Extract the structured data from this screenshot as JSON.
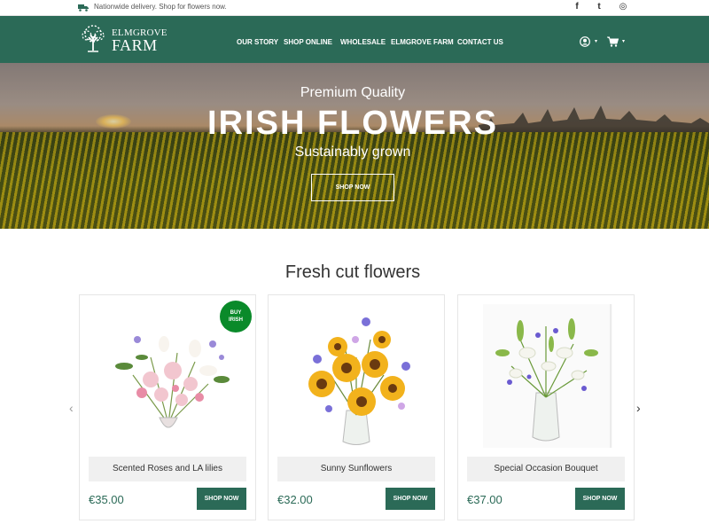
{
  "topbar": {
    "promo": "Nationwide delivery. Shop for flowers now.",
    "social": [
      {
        "icon": "facebook-icon",
        "glyph": "f"
      },
      {
        "icon": "twitter-icon",
        "glyph": "t"
      },
      {
        "icon": "instagram-icon",
        "glyph": "◎"
      }
    ]
  },
  "header": {
    "logo_line1": "ELMGROVE",
    "logo_line2": "FARM",
    "nav": [
      "OUR STORY",
      "SHOP ONLINE",
      "WHOLESALE",
      "ELMGROVE FARM",
      "CONTACT US"
    ],
    "account_icon": "user-circle-icon",
    "cart_icon": "cart-icon"
  },
  "hero": {
    "kicker": "Premium Quality",
    "headline": "IRISH FLOWERS",
    "subtitle": "Sustainably grown",
    "cta": "SHOP NOW"
  },
  "section": {
    "title": "Fresh cut flowers",
    "prev_arrow": "‹",
    "next_arrow": "›"
  },
  "products": [
    {
      "name": "Scented Roses and LA lilies",
      "price": "€35.00",
      "button": "SHOP NOW",
      "badge": "BUY IRISH"
    },
    {
      "name": "Sunny Sunflowers",
      "price": "€32.00",
      "button": "SHOP NOW"
    },
    {
      "name": "Special Occasion Bouquet",
      "price": "€37.00",
      "button": "SHOP NOW"
    }
  ],
  "colors": {
    "brand_green": "#2b6a57",
    "badge_green": "#0a8a2a"
  }
}
